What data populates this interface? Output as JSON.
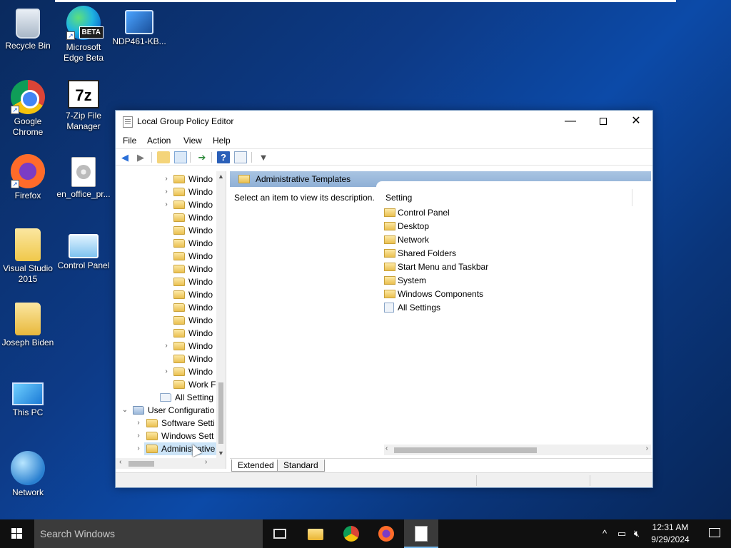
{
  "desktop": {
    "icons": [
      {
        "label": "Recycle Bin"
      },
      {
        "label": "Microsoft Edge Beta",
        "badge": "BETA"
      },
      {
        "label": "NDP461-KB..."
      },
      {
        "label": "Google Chrome"
      },
      {
        "label": "7-Zip File Manager",
        "glyph": "7z"
      },
      {
        "label": "Firefox"
      },
      {
        "label": "en_office_pr..."
      },
      {
        "label": "Visual Studio 2015"
      },
      {
        "label": "Control Panel"
      },
      {
        "label": "Joseph Biden"
      },
      {
        "label": "This PC"
      },
      {
        "label": "Network"
      }
    ]
  },
  "window": {
    "title": "Local Group Policy Editor",
    "controls": {
      "minimize": "—",
      "close": "✕"
    },
    "menu": [
      "File",
      "Action",
      "View",
      "Help"
    ],
    "toolbar": {
      "back": "◀",
      "forward": "▶",
      "help": "?",
      "filter": "▼"
    },
    "tree": {
      "items": [
        {
          "text": "Windo",
          "expandable": true
        },
        {
          "text": "Windo",
          "expandable": true
        },
        {
          "text": "Windo",
          "expandable": true
        },
        {
          "text": "Windo",
          "expandable": false
        },
        {
          "text": "Windo",
          "expandable": false
        },
        {
          "text": "Windo",
          "expandable": false
        },
        {
          "text": "Windo",
          "expandable": false
        },
        {
          "text": "Windo",
          "expandable": false
        },
        {
          "text": "Windo",
          "expandable": false
        },
        {
          "text": "Windo",
          "expandable": false
        },
        {
          "text": "Windo",
          "expandable": false
        },
        {
          "text": "Windo",
          "expandable": false
        },
        {
          "text": "Windo",
          "expandable": false
        },
        {
          "text": "Windo",
          "expandable": true
        },
        {
          "text": "Windo",
          "expandable": false
        },
        {
          "text": "Windo",
          "expandable": true
        },
        {
          "text": "Work F",
          "expandable": false
        },
        {
          "text": "All Setting",
          "expandable": false
        }
      ],
      "user_config": "User Configuratio",
      "user_children": [
        {
          "text": "Software Setti"
        },
        {
          "text": "Windows Sett"
        },
        {
          "text": "Administrative"
        }
      ]
    },
    "right": {
      "header": "Administrative Templates",
      "description": "Select an item to view its description.",
      "column_header": "Setting",
      "settings": [
        {
          "text": "Control Panel",
          "icon": "folder"
        },
        {
          "text": "Desktop",
          "icon": "folder"
        },
        {
          "text": "Network",
          "icon": "folder"
        },
        {
          "text": "Shared Folders",
          "icon": "folder"
        },
        {
          "text": "Start Menu and Taskbar",
          "icon": "folder"
        },
        {
          "text": "System",
          "icon": "folder"
        },
        {
          "text": "Windows Components",
          "icon": "folder"
        },
        {
          "text": "All Settings",
          "icon": "settings"
        }
      ]
    },
    "tabs": [
      "Extended",
      "Standard"
    ]
  },
  "taskbar": {
    "search_placeholder": "Search Windows",
    "clock_time": "12:31 AM",
    "clock_date": "9/29/2024",
    "tray_chevron": "^"
  }
}
